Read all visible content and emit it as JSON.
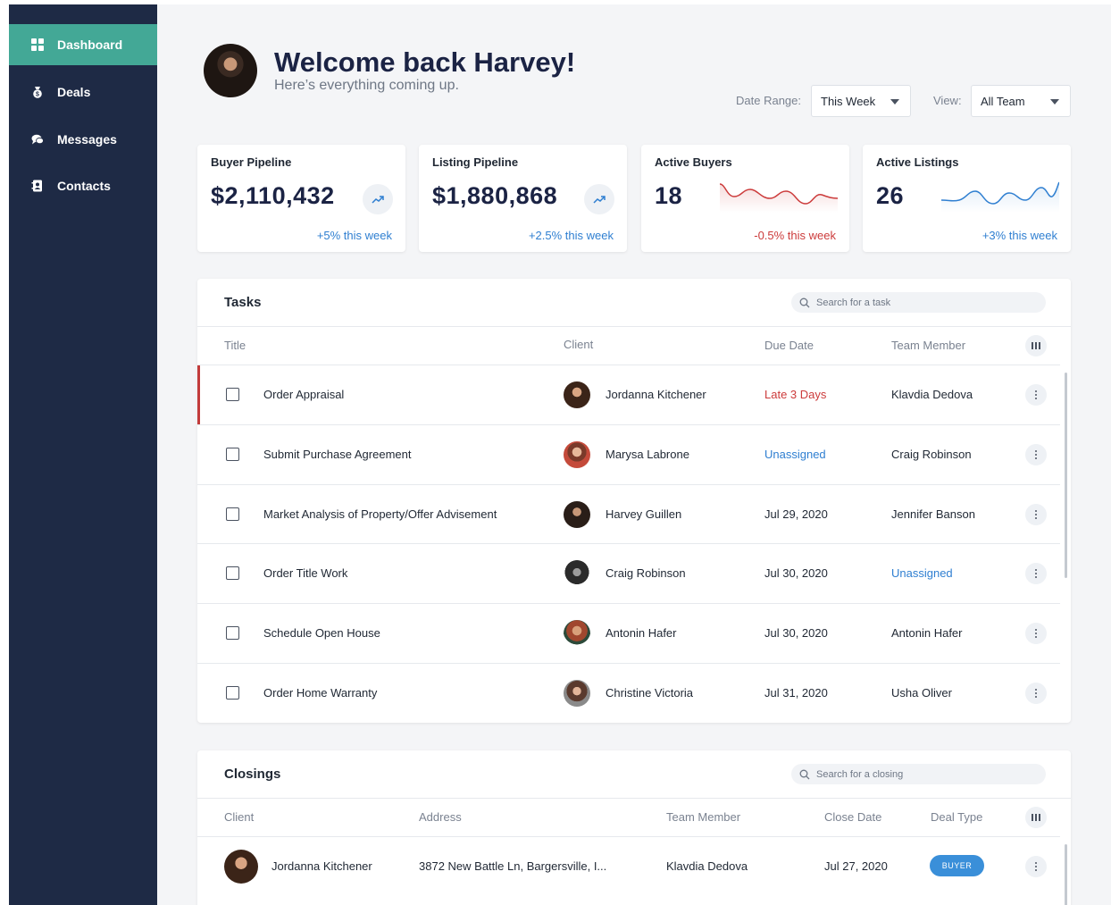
{
  "sidebar": {
    "items": [
      {
        "label": "Dashboard",
        "icon": "dashboard-icon",
        "active": true
      },
      {
        "label": "Deals",
        "icon": "money-bag-icon",
        "active": false
      },
      {
        "label": "Messages",
        "icon": "chat-bubbles-icon",
        "active": false
      },
      {
        "label": "Contacts",
        "icon": "contact-book-icon",
        "active": false
      }
    ]
  },
  "header": {
    "welcome": "Welcome back Harvey!",
    "subtitle": "Here’s everything coming up.",
    "date_range_label": "Date Range:",
    "date_range_value": "This Week",
    "view_label": "View:",
    "view_value": "All Team"
  },
  "stats": [
    {
      "title": "Buyer Pipeline",
      "value": "$2,110,432",
      "change": "+5% this week",
      "trend": "up",
      "color": "#2f7fd1"
    },
    {
      "title": "Listing Pipeline",
      "value": "$1,880,868",
      "change": "+2.5% this week",
      "trend": "up",
      "color": "#2f7fd1"
    },
    {
      "title": "Active Buyers",
      "value": "18",
      "change": "-0.5% this week",
      "trend": "down",
      "color": "#cc3b3b"
    },
    {
      "title": "Active Listings",
      "value": "26",
      "change": "+3% this week",
      "trend": "up",
      "color": "#2f7fd1"
    }
  ],
  "tasks": {
    "title": "Tasks",
    "search_placeholder": "Search for a task",
    "columns": [
      "Title",
      "Client",
      "Due Date",
      "Team Member"
    ],
    "rows": [
      {
        "title": "Order Appraisal",
        "client": "Jordanna Kitchener",
        "due": "Late 3 Days",
        "due_status": "late",
        "member": "Klavdia Dedova",
        "member_status": "normal"
      },
      {
        "title": "Submit Purchase Agreement",
        "client": "Marysa Labrone",
        "due": "Unassigned",
        "due_status": "unassigned",
        "member": "Craig Robinson",
        "member_status": "normal"
      },
      {
        "title": "Market Analysis of Property/Offer Advisement",
        "client": "Harvey Guillen",
        "due": "Jul 29, 2020",
        "due_status": "normal",
        "member": "Jennifer Banson",
        "member_status": "normal"
      },
      {
        "title": "Order Title Work",
        "client": "Craig Robinson",
        "due": "Jul 30, 2020",
        "due_status": "normal",
        "member": "Unassigned",
        "member_status": "unassigned"
      },
      {
        "title": "Schedule Open House",
        "client": "Antonin Hafer",
        "due": "Jul 30, 2020",
        "due_status": "normal",
        "member": "Antonin Hafer",
        "member_status": "normal"
      },
      {
        "title": "Order Home Warranty",
        "client": "Christine Victoria",
        "due": "Jul 31, 2020",
        "due_status": "normal",
        "member": "Usha Oliver",
        "member_status": "normal"
      }
    ]
  },
  "closings": {
    "title": "Closings",
    "search_placeholder": "Search for a closing",
    "columns": [
      "Client",
      "Address",
      "Team Member",
      "Close Date",
      "Deal Type"
    ],
    "rows": [
      {
        "client": "Jordanna Kitchener",
        "address": "3872 New Battle Ln, Bargersville, I...",
        "member": "Klavdia Dedova",
        "close_date": "Jul 27, 2020",
        "deal_type": "BUYER"
      }
    ]
  },
  "colors": {
    "accent": "#43a896",
    "sidebar": "#1e2a45",
    "late": "#cc3b3b",
    "link": "#2f7fd1"
  }
}
